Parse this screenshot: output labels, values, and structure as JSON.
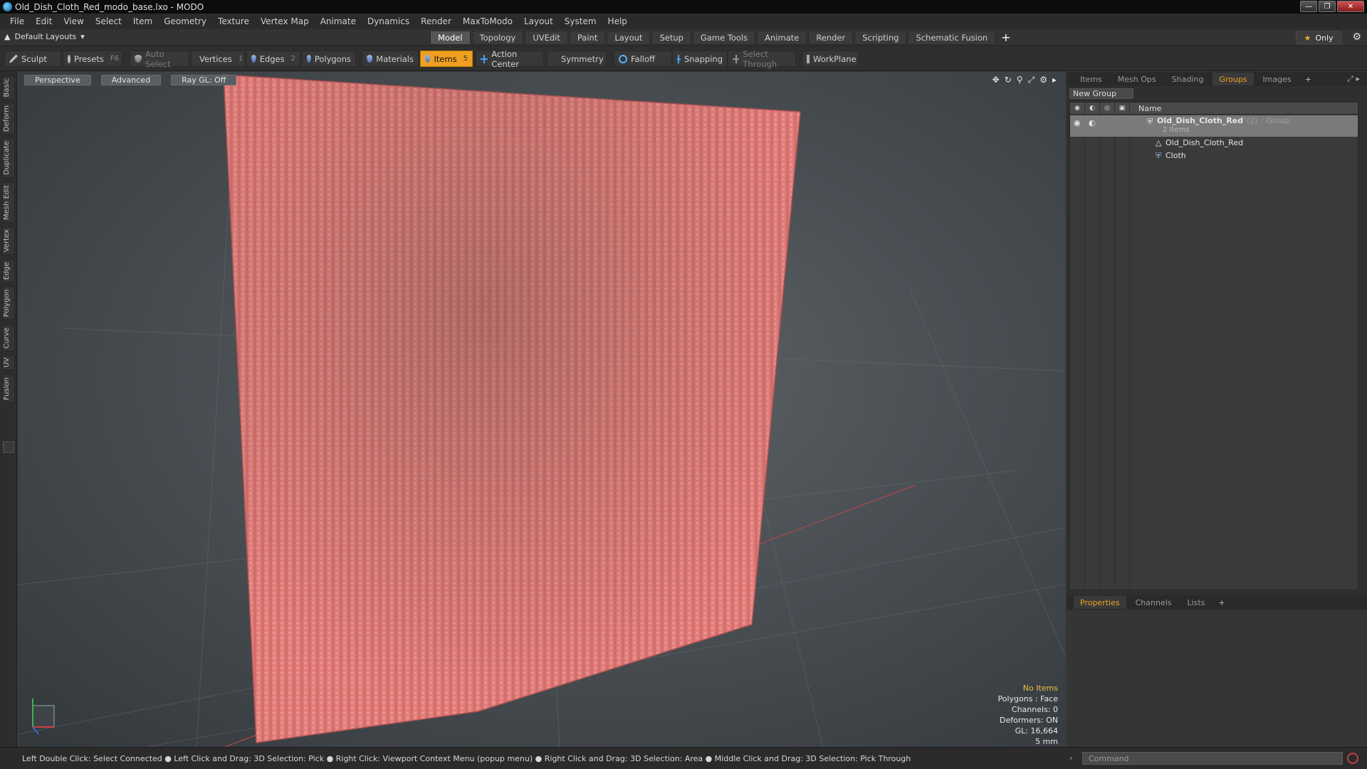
{
  "window": {
    "title": "Old_Dish_Cloth_Red_modo_base.lxo - MODO"
  },
  "menu": [
    "File",
    "Edit",
    "View",
    "Select",
    "Item",
    "Geometry",
    "Texture",
    "Vertex Map",
    "Animate",
    "Dynamics",
    "Render",
    "MaxToModo",
    "Layout",
    "System",
    "Help"
  ],
  "layout": {
    "selector": "Default Layouts",
    "tabs": [
      "Model",
      "Topology",
      "UVEdit",
      "Paint",
      "Layout",
      "Setup",
      "Game Tools",
      "Animate",
      "Render",
      "Scripting",
      "Schematic Fusion"
    ],
    "active_tab": "Model",
    "only_label": "Only"
  },
  "toolbar": {
    "sculpt": "Sculpt",
    "presets": "Presets",
    "presets_key": "F6",
    "auto_select": "Auto Select",
    "vertices": "Vertices",
    "vertices_count": "1",
    "edges": "Edges",
    "edges_count": "2",
    "polygons": "Polygons",
    "materials": "Materials",
    "items": "Items",
    "items_count": "5",
    "action_center": "Action Center",
    "symmetry": "Symmetry",
    "falloff": "Falloff",
    "snapping": "Snapping",
    "select_through": "Select Through",
    "workplane": "WorkPlane"
  },
  "left_tabs": [
    "Basic",
    "Deform",
    "Duplicate",
    "Mesh Edit",
    "Vertex",
    "Edge",
    "Polygon",
    "Curve",
    "UV",
    "Fusion"
  ],
  "viewport": {
    "view": "Perspective",
    "shading": "Advanced",
    "raygl": "Ray GL: Off",
    "info": {
      "no_items": "No Items",
      "polygons": "Polygons : Face",
      "channels": "Channels: 0",
      "deformers": "Deformers: ON",
      "gl": "GL: 16,664",
      "unit": "5 mm"
    }
  },
  "right_panel": {
    "tabs": [
      "Items",
      "Mesh Ops",
      "Shading",
      "Groups",
      "Images"
    ],
    "active_tab": "Groups",
    "new_group": "New Group",
    "column_name": "Name",
    "group": {
      "name": "Old_Dish_Cloth_Red",
      "count": "(2)",
      "type": ": Group",
      "sub": "2 Items"
    },
    "children": [
      "Old_Dish_Cloth_Red",
      "Cloth"
    ],
    "bottom_tabs": [
      "Properties",
      "Channels",
      "Lists"
    ],
    "bottom_active": "Properties"
  },
  "status": {
    "hint": "Left Double Click: Select Connected ● Left Click and Drag: 3D Selection: Pick ● Right Click: Viewport Context Menu (popup menu) ● Right Click and Drag: 3D Selection: Area ● Middle Click and Drag: 3D Selection: Pick Through",
    "command_placeholder": "Command"
  },
  "colors": {
    "accent": "#f0a020",
    "cloth": "#e07a78"
  }
}
